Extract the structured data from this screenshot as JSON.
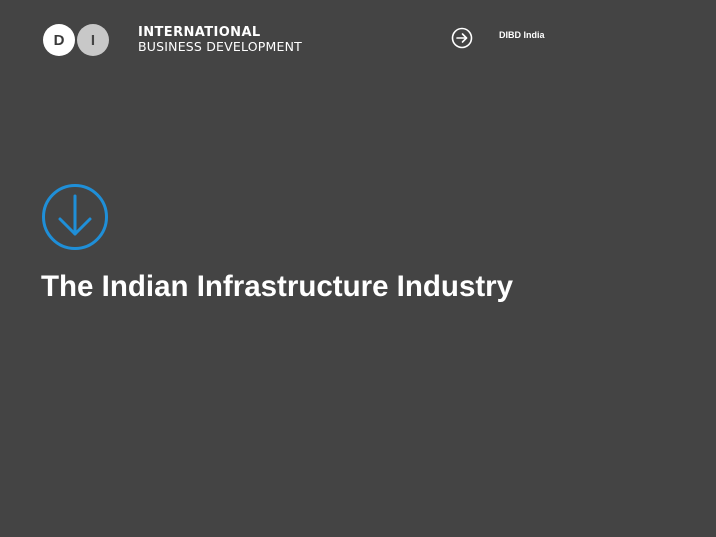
{
  "header": {
    "logo": {
      "letter_d": "D",
      "letter_i": "I"
    },
    "org_name_line1": "INTERNATIONAL",
    "org_name_line2": "BUSINESS DEVELOPMENT",
    "nav_icon": "arrow-right-circle-icon",
    "nav_label": "DIBD India"
  },
  "main": {
    "icon": "arrow-down-circle-icon",
    "title": "The Indian Infrastructure Industry"
  },
  "colors": {
    "background": "#444444",
    "accent": "#1f8fd8",
    "text": "#ffffff",
    "logo_d_bg": "#ffffff",
    "logo_i_bg": "#c8c8c8"
  }
}
